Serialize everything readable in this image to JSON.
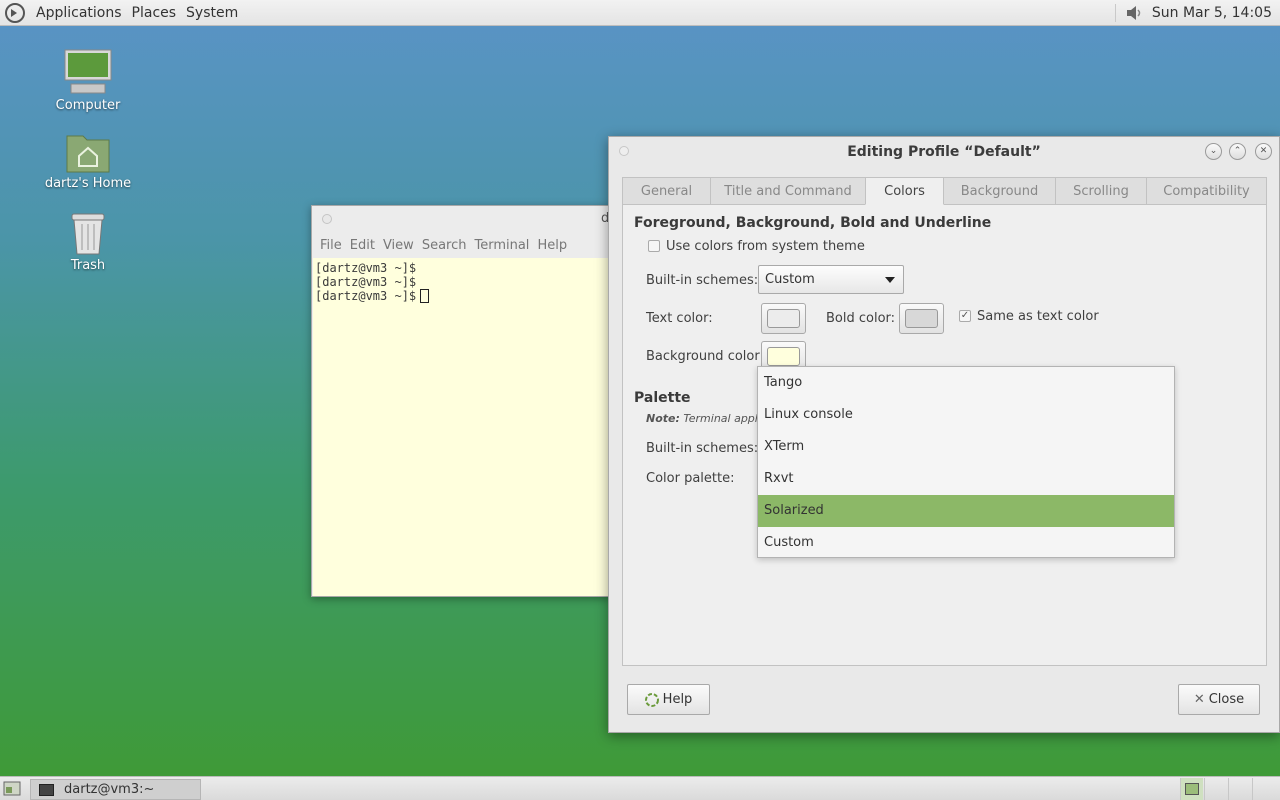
{
  "top_panel": {
    "menus": [
      "Applications",
      "Places",
      "System"
    ],
    "clock": "Sun Mar 5, 14:05",
    "icons": [
      "mate-logo-icon",
      "volume-icon"
    ]
  },
  "desktop": {
    "icons": [
      {
        "label": "Computer",
        "icon": "computer-icon"
      },
      {
        "label": "dartz's Home",
        "icon": "home-folder-icon"
      },
      {
        "label": "Trash",
        "icon": "trash-icon"
      }
    ]
  },
  "terminal": {
    "title_fragment": "d",
    "menus": [
      "File",
      "Edit",
      "View",
      "Search",
      "Terminal",
      "Help"
    ],
    "lines": [
      "[dartz@vm3 ~]$",
      "[dartz@vm3 ~]$",
      "[dartz@vm3 ~]$"
    ]
  },
  "dialog": {
    "title": "Editing Profile “Default”",
    "tabs": [
      "General",
      "Title and Command",
      "Colors",
      "Background",
      "Scrolling",
      "Compatibility"
    ],
    "active_tab": "Colors",
    "fg_section": {
      "heading": "Foreground, Background, Bold and Underline",
      "use_system_colors": "Use colors from system theme",
      "builtin_label": "Built-in schemes:",
      "builtin_value": "Custom",
      "text_color_label": "Text color:",
      "bold_color_label": "Bold color:",
      "same_as_text": "Same as text color",
      "bg_color_label": "Background color:"
    },
    "palette_section": {
      "heading": "Palette",
      "note_bold": "Note:",
      "note_text": "Terminal applicat",
      "builtin_label": "Built-in schemes:",
      "palette_label": "Color palette:"
    },
    "dropdown_options": [
      "Tango",
      "Linux console",
      "XTerm",
      "Rxvt",
      "Solarized",
      "Custom"
    ],
    "dropdown_highlighted": "Solarized",
    "help_button": "Help",
    "close_button": "Close"
  },
  "taskbar": {
    "task_label": "dartz@vm3:~"
  },
  "colors": {
    "terminal_bg": "#ffffdd",
    "highlight": "#8cb867",
    "text_swatch": "#ececec",
    "bold_swatch": "#d8d8d8",
    "bg_swatch": "#ffffdd"
  }
}
